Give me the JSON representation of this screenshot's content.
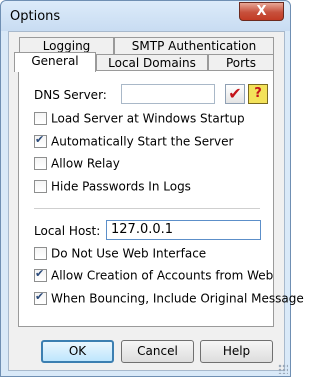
{
  "window": {
    "title": "Options",
    "close_glyph": "X"
  },
  "tabs": {
    "back": [
      {
        "label": "Logging",
        "accel": "L"
      },
      {
        "label": "SMTP Authentication",
        "accel": ""
      }
    ],
    "front": [
      {
        "label": "General",
        "accel": "G",
        "active": true
      },
      {
        "label": "Local Domains",
        "accel": "L",
        "active": false
      },
      {
        "label": "Ports",
        "accel": "P",
        "active": false
      }
    ]
  },
  "general": {
    "dns_label": "DNS Server:",
    "dns_value": "",
    "dns_check_glyph": "✔",
    "dns_help_glyph": "?",
    "checkboxes_top": [
      {
        "label": "Load Server at Windows Startup",
        "checked": false
      },
      {
        "label": "Automatically Start the Server",
        "checked": true
      },
      {
        "label": "Allow Relay",
        "checked": false
      },
      {
        "label": "Hide Passwords In Logs",
        "checked": false
      }
    ],
    "localhost_label": "Local Host:",
    "localhost_value": "127.0.0.1",
    "checkboxes_bottom": [
      {
        "label": "Do Not Use Web Interface",
        "checked": false
      },
      {
        "label": "Allow Creation of Accounts from Web",
        "checked": true
      },
      {
        "label": "When Bouncing, Include Original Message",
        "checked": true
      }
    ]
  },
  "buttons": {
    "ok": "OK",
    "cancel": "Cancel",
    "help": "Help"
  }
}
